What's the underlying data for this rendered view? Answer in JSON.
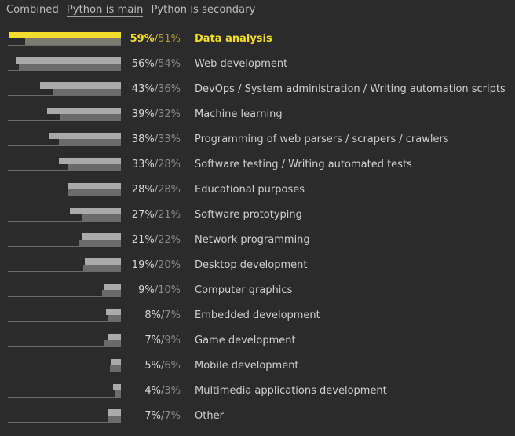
{
  "tabs": {
    "combined": "Combined",
    "python_main": "Python is main",
    "python_secondary": "Python is secondary",
    "active": "python_main"
  },
  "colors": {
    "background": "#2b2b2c",
    "highlight": "#f2dc2c",
    "main_bar": "#aaaaaa",
    "secondary_bar": "#6b6b6b"
  },
  "chart_data": {
    "type": "bar",
    "orientation": "horizontal",
    "highlighted_category": "Data analysis",
    "categories": [
      "Data analysis",
      "Web development",
      "DevOps / System administration / Writing automation scripts",
      "Machine learning",
      "Programming of web parsers / scrapers / crawlers",
      "Software testing / Writing automated tests",
      "Educational purposes",
      "Software prototyping",
      "Network programming",
      "Desktop development",
      "Computer graphics",
      "Embedded development",
      "Game development",
      "Mobile development",
      "Multimedia applications development",
      "Other"
    ],
    "series": [
      {
        "values": [
          59,
          56,
          43,
          39,
          38,
          33,
          28,
          27,
          21,
          19,
          9,
          8,
          7,
          5,
          4,
          7
        ]
      },
      {
        "values": [
          51,
          54,
          36,
          32,
          33,
          28,
          28,
          21,
          22,
          20,
          10,
          7,
          9,
          6,
          3,
          7
        ]
      }
    ],
    "value_suffix": "%",
    "separator": "/",
    "xlim": [
      0,
      60
    ]
  }
}
